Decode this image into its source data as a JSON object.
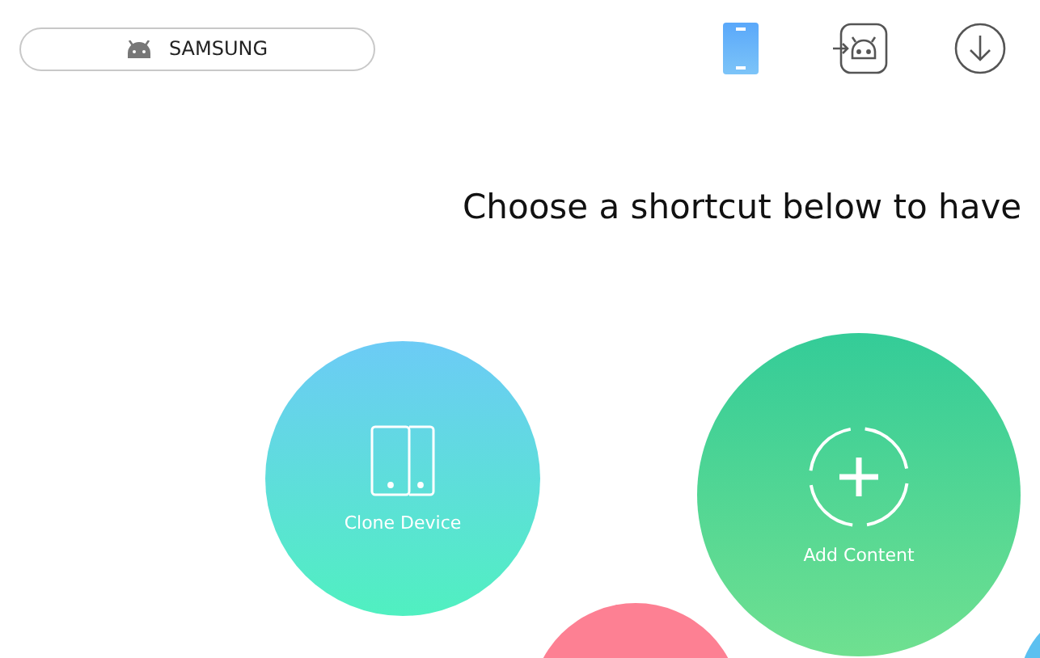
{
  "device": {
    "name": "SAMSUNG"
  },
  "toolbar": [
    {
      "kind": "phone",
      "selected": true
    },
    {
      "kind": "import",
      "selected": false
    },
    {
      "kind": "download",
      "selected": false
    }
  ],
  "heading": "Choose a shortcut below to have",
  "shortcuts": [
    {
      "kind": "clone",
      "label": "Clone Device"
    },
    {
      "kind": "add",
      "label": "Add Content"
    },
    {
      "kind": "pink"
    },
    {
      "kind": "blue"
    }
  ]
}
